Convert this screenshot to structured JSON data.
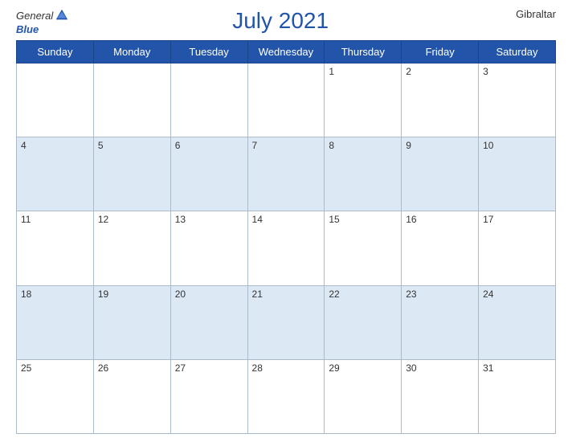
{
  "header": {
    "logo_general": "General",
    "logo_blue": "Blue",
    "title": "July 2021",
    "country": "Gibraltar"
  },
  "days_of_week": [
    "Sunday",
    "Monday",
    "Tuesday",
    "Wednesday",
    "Thursday",
    "Friday",
    "Saturday"
  ],
  "weeks": [
    [
      "",
      "",
      "",
      "",
      "1",
      "2",
      "3"
    ],
    [
      "4",
      "5",
      "6",
      "7",
      "8",
      "9",
      "10"
    ],
    [
      "11",
      "12",
      "13",
      "14",
      "15",
      "16",
      "17"
    ],
    [
      "18",
      "19",
      "20",
      "21",
      "22",
      "23",
      "24"
    ],
    [
      "25",
      "26",
      "27",
      "28",
      "29",
      "30",
      "31"
    ]
  ]
}
